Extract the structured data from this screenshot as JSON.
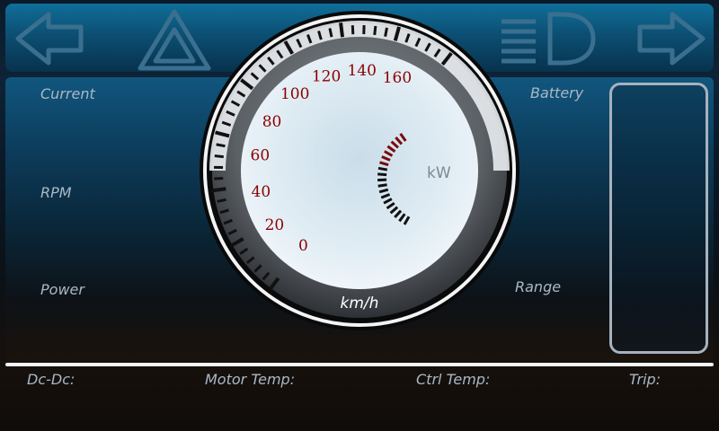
{
  "colors": {
    "accent": "#0f6f9a",
    "scale_text": "#8b0000",
    "kw_red": "#7a0a0a"
  },
  "top_icons": [
    "left-arrow-icon",
    "hazard-warning-icon",
    "headlight-icon",
    "right-arrow-icon"
  ],
  "left_panel": {
    "current_label": "Current",
    "rpm_label": "RPM",
    "power_label": "Power"
  },
  "right_panel": {
    "battery_label": "Battery",
    "range_label": "Range",
    "battery_level": 0
  },
  "gauge": {
    "speed_labels": [
      "0",
      "20",
      "40",
      "60",
      "80",
      "100",
      "120",
      "140",
      "160"
    ],
    "unit_label": "km/h",
    "kw_label": "kW"
  },
  "bottom": {
    "dcdc": "Dc-Dc:",
    "motor_temp": "Motor Temp:",
    "ctrl_temp": "Ctrl Temp:",
    "trip": "Trip:"
  }
}
